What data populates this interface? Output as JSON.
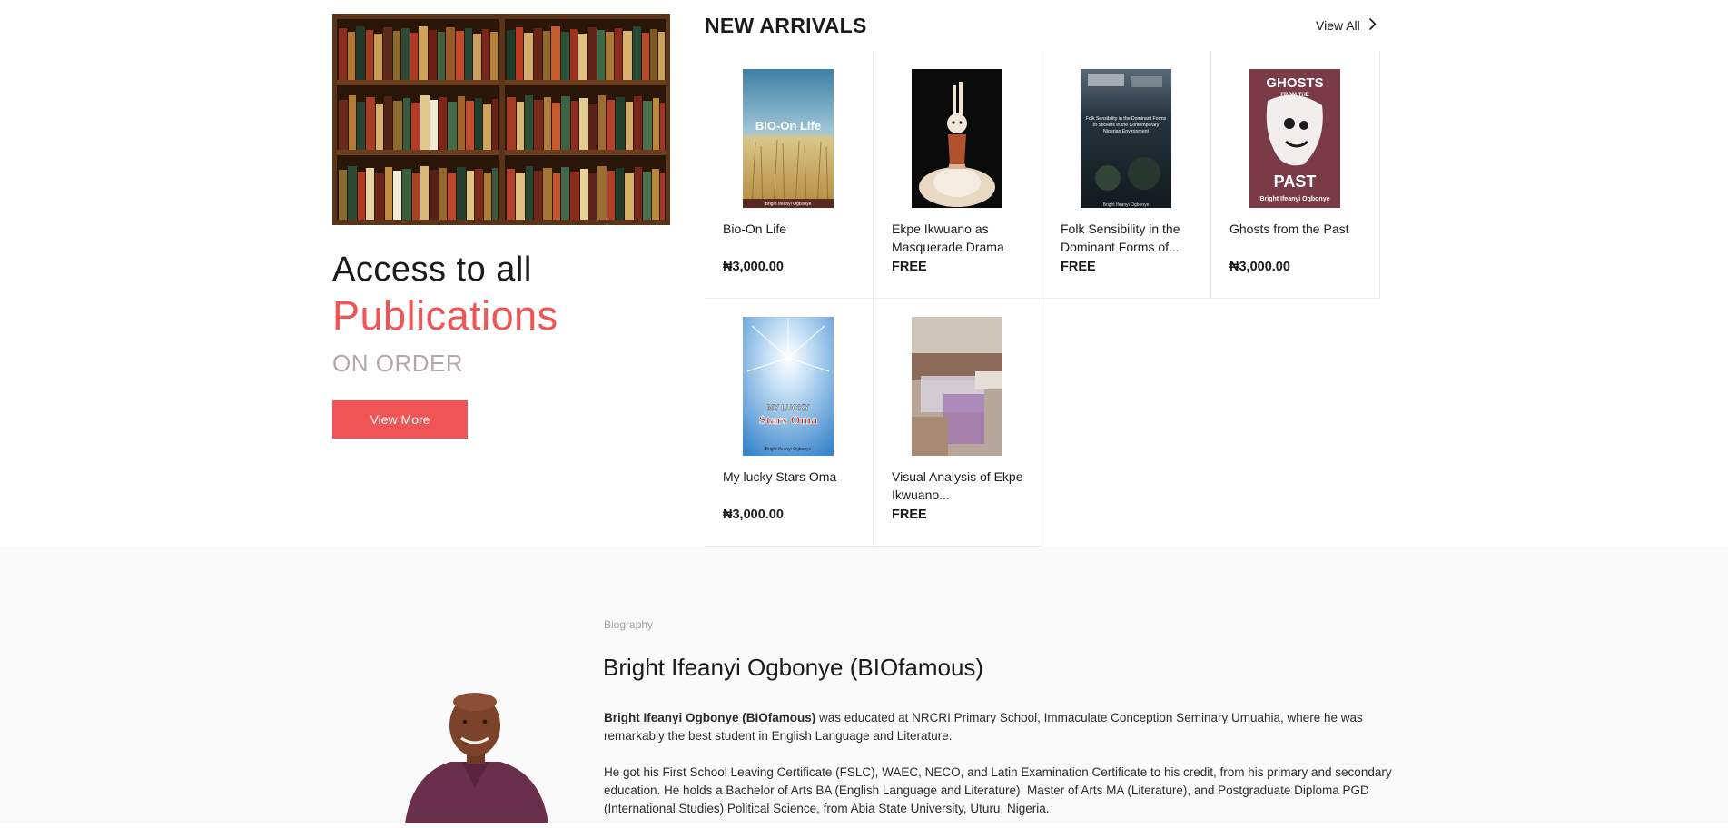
{
  "promo": {
    "title_line1": "Access to all",
    "title_line2": "Publications",
    "title_line3": "ON ORDER",
    "button_label": "View More"
  },
  "new_arrivals": {
    "heading": "NEW ARRIVALS",
    "view_all_label": "View All",
    "products": [
      {
        "title": "Bio-On Life",
        "price": "₦3,000.00",
        "cover_text": "BIO-On Life",
        "cover_author": "Bright Ifeanyi Ogbonye"
      },
      {
        "title": "Ekpe Ikwuano as Masquerade Drama",
        "price": "FREE"
      },
      {
        "title": "Folk Sensibility in the Dominant Forms of...",
        "price": "FREE",
        "cover_text": "Folk Sensibility in the Dominant Forms of Stickers in the Contemporary Nigerian Environment",
        "cover_author": "Bright Ifeanyi Ogbonye"
      },
      {
        "title": "Ghosts from the Past",
        "price": "₦3,000.00",
        "cover_text_top": "GHOSTS",
        "cover_text_mid": "FROM THE",
        "cover_text_bottom": "PAST",
        "cover_author": "Bright Ifeanyi Ogbonye"
      },
      {
        "title": "My lucky Stars Oma",
        "price": "₦3,000.00",
        "cover_text_top": "MY LUCKY",
        "cover_text_bottom": "Stars Oma",
        "cover_author": "Bright Ifeanyi Ogbonye"
      },
      {
        "title": "Visual Analysis of Ekpe Ikwuano...",
        "price": "FREE"
      }
    ]
  },
  "biography": {
    "label": "Biography",
    "name": "Bright Ifeanyi Ogbonye (BIOfamous)",
    "p1_bold": "Bright Ifeanyi Ogbonye (BIOfamous)",
    "p1_rest": " was educated at NRCRI Primary School, Immaculate Conception Seminary Umuahia, where he was remarkably the best student in English Language and Literature.",
    "p2": "He got his First School Leaving Certificate (FSLC), WAEC, NECO, and Latin Examination Certificate to his credit, from his primary and secondary education. He holds a Bachelor of Arts BA (English Language and Literature), Master of Arts MA (Literature), and Postgraduate Diploma PGD (International Studies) Political Science, from Abia State University, Uturu, Nigeria."
  },
  "colors": {
    "accent": "#f05454",
    "muted": "#b4a8a8",
    "text": "#1b1b1b",
    "section_bg": "#fafafa"
  },
  "icons": {
    "view_all": "chevron-right-icon"
  }
}
